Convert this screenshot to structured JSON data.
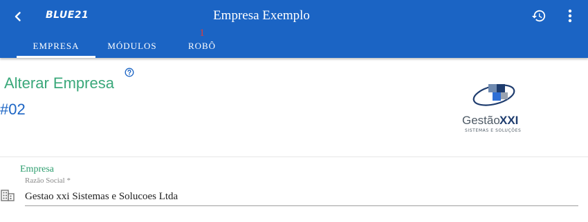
{
  "app": {
    "logo_text": "BLUE21",
    "title": "Empresa Exemplo",
    "accent_color": "#1b64c4",
    "icons": {
      "back": "chevron-left-icon",
      "history": "history-icon",
      "more": "more-vert-icon"
    }
  },
  "tabs": [
    {
      "label": "EMPRESA",
      "active": true
    },
    {
      "label": "MÓDULOS",
      "active": false
    },
    {
      "label": "ROBÔ",
      "active": false,
      "badge": "1"
    }
  ],
  "page": {
    "heading": "Alterar Empresa",
    "code": "#02",
    "help_icon": "help-circle-icon",
    "brand_logo": {
      "name": "GestãoXXI",
      "tagline": "SISTEMAS E SOLUÇÕES"
    }
  },
  "form": {
    "section_title": "Empresa",
    "fields": [
      {
        "label": "Razão Social *",
        "value": "Gestao xxi Sistemas e Solucoes Ltda",
        "icon": "building-icon"
      }
    ]
  }
}
